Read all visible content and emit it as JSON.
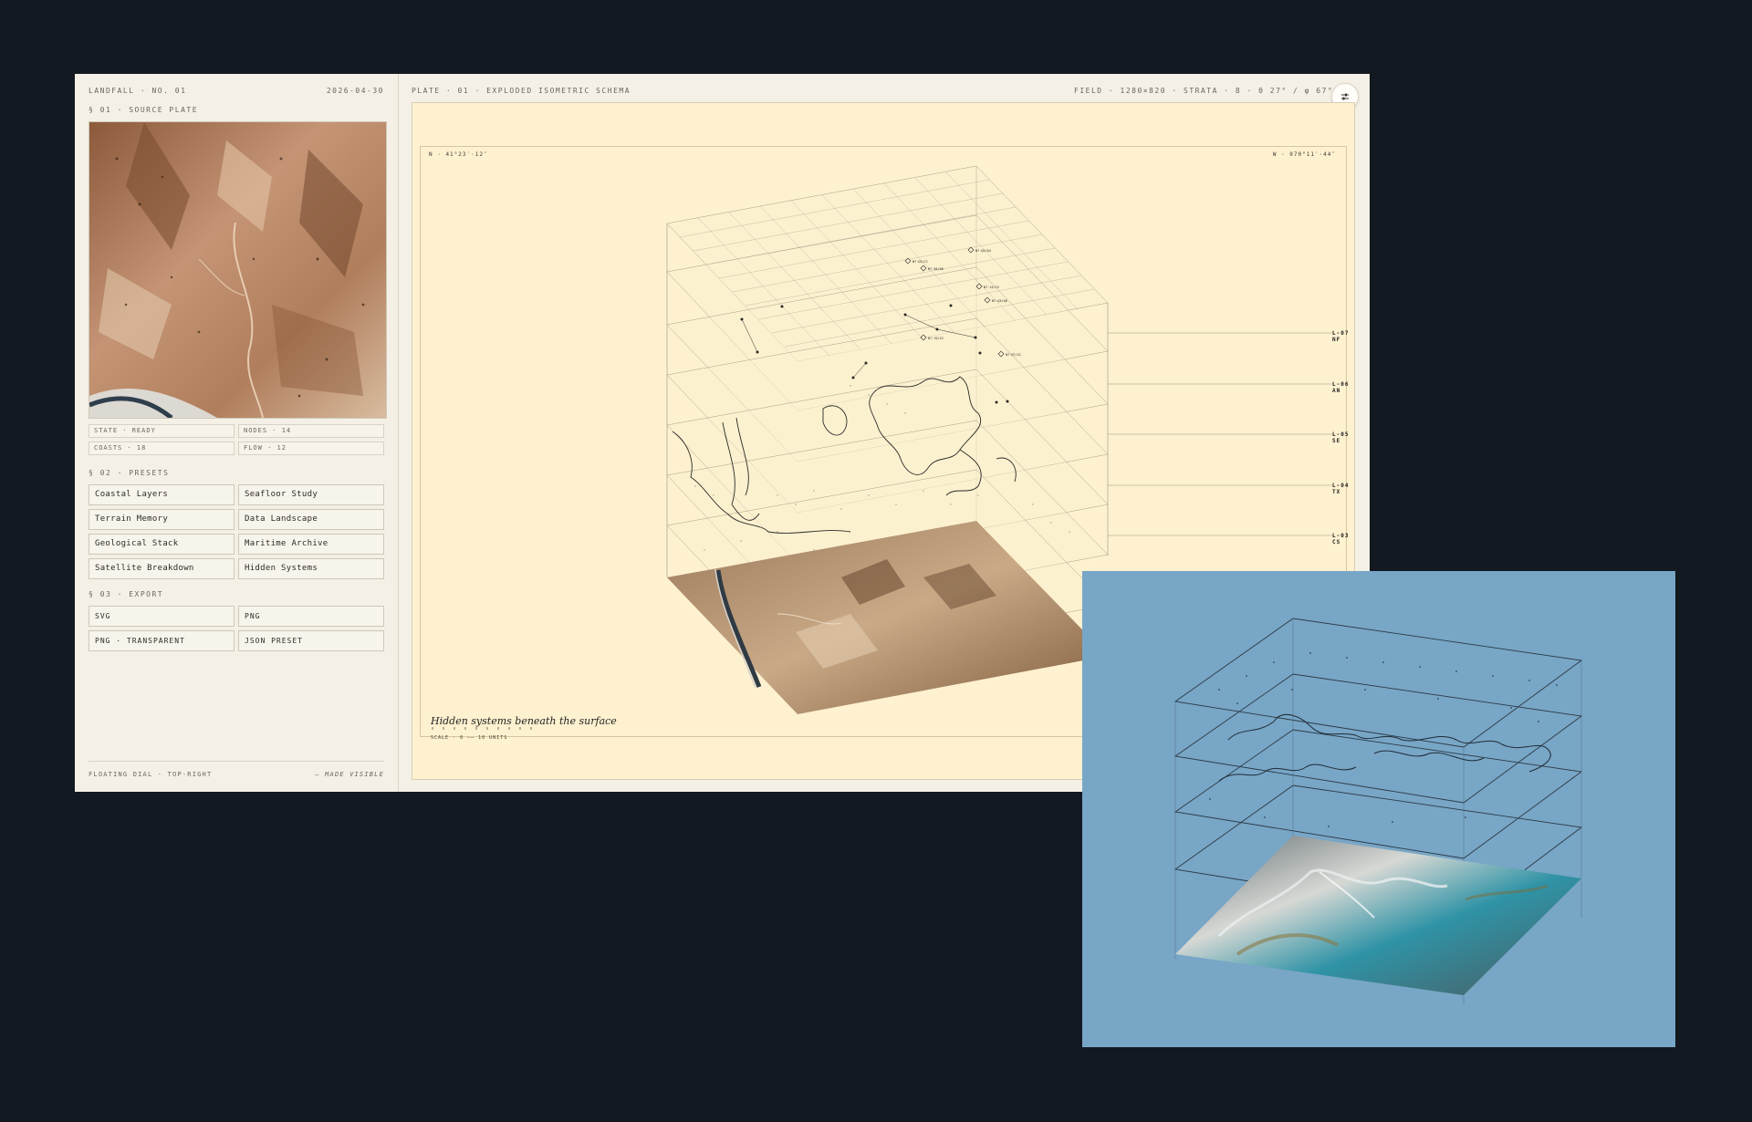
{
  "sidebar": {
    "brand": "LANDFALL · NO. 01",
    "date": "2026-04-30",
    "source_section": "§ 01 · SOURCE PLATE",
    "stats": [
      "STATE · READY",
      "NODES · 14",
      "COASTS · 18",
      "FLOW · 12"
    ],
    "presets_section": "§ 02 · PRESETS",
    "presets": [
      "Coastal Layers",
      "Seafloor Study",
      "Terrain Memory",
      "Data Landscape",
      "Geological Stack",
      "Maritime Archive",
      "Satellite Breakdown",
      "Hidden Systems"
    ],
    "export_section": "§ 03 · EXPORT",
    "exports": [
      "SVG",
      "PNG",
      "PNG · TRANSPARENT",
      "JSON PRESET"
    ],
    "footer_left": "FLOATING DIAL · TOP-RIGHT",
    "footer_right": "— MADE VISIBLE"
  },
  "main": {
    "title": "PLATE · 01 · EXPLODED ISOMETRIC SCHEMA",
    "field": "FIELD · 1280×820 · STRATA · 8 · θ 27° / φ 67° · EXPLOD",
    "coord_left": "N · 41°23′·12″",
    "coord_right": "W · 070°11′·44″",
    "caption": "Hidden systems beneath the surface",
    "scale": "SCALE · 0 —— 10 UNITS",
    "layers": [
      "L-07 NF",
      "L-06 AN",
      "L-05 SE",
      "L-04 TX",
      "L-03 CS"
    ],
    "node_tags": [
      "N7·Q3/71",
      "N7·58/06",
      "N7·Q5/Q4",
      "N7·14/15",
      "N7·Q3/Q6",
      "N7·70/22",
      "N7·Q7/21"
    ]
  },
  "colors": {
    "page_bg": "#121920",
    "panel_bg": "#f4f0e6",
    "canvas_bg": "#fdf1cf",
    "overlay_bg": "#78a6c6",
    "ink": "#3d3a33"
  }
}
